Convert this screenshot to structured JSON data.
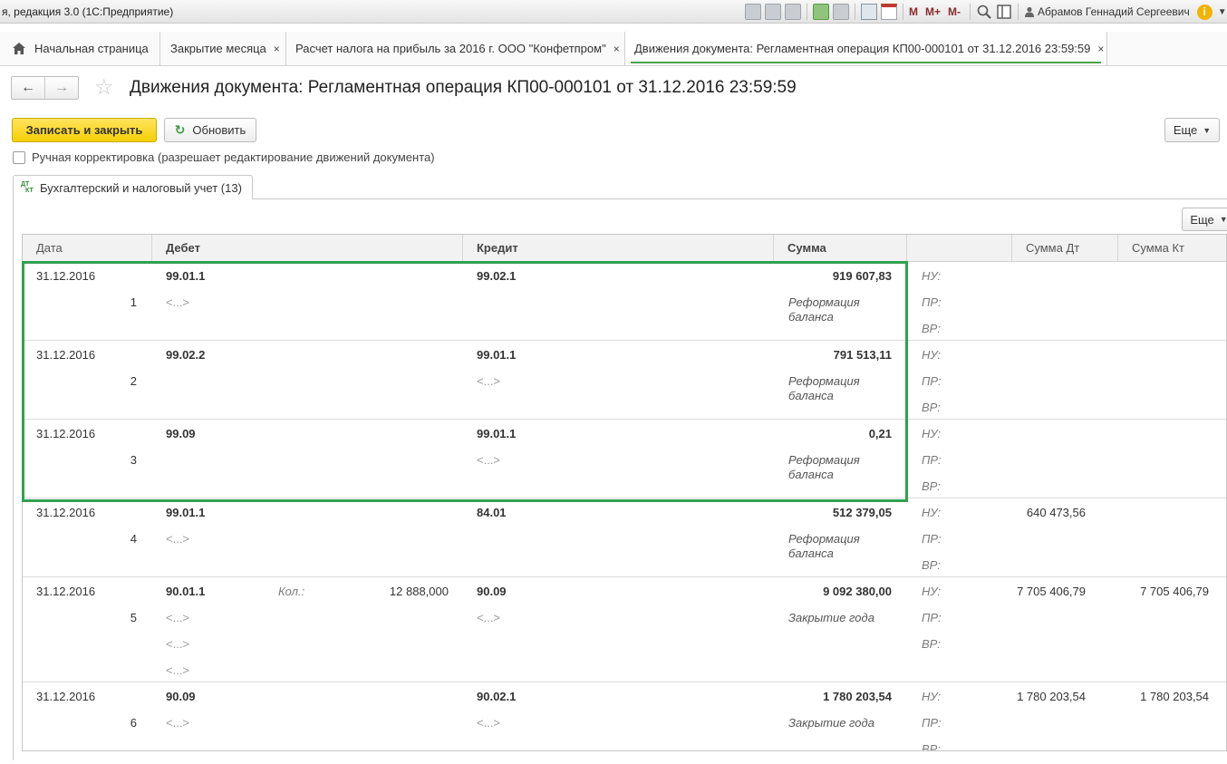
{
  "window": {
    "title": "я, редакция 3.0  (1С:Предприятие)",
    "user_name": "Абрамов Геннадий Сергеевич",
    "toolbar_labels": [
      "M",
      "M+",
      "M-"
    ]
  },
  "tabs": [
    {
      "label": "Начальная страница",
      "icon": "home-icon",
      "closable": false
    },
    {
      "label": "Закрытие месяца",
      "closable": true
    },
    {
      "label": "Расчет налога на прибыль за 2016 г. ООО \"Конфетпром\"",
      "closable": true
    },
    {
      "label": "Движения документа: Регламентная операция КП00-000101 от 31.12.2016 23:59:59",
      "closable": true,
      "active": true
    }
  ],
  "close_glyph": "×",
  "page": {
    "title": "Движения документа: Регламентная операция КП00-000101 от 31.12.2016 23:59:59",
    "back_glyph": "←",
    "forward_glyph": "→",
    "star_glyph": "☆"
  },
  "toolbar": {
    "save_close_label": "Записать и закрыть",
    "refresh_label": "Обновить",
    "more_label": "Еще"
  },
  "manual_edit": {
    "label": "Ручная корректировка (разрешает редактирование движений документа)",
    "checked": false
  },
  "inner_tab": {
    "label": "Бухгалтерский и налоговый учет (13)",
    "icon_top": "ДТ",
    "icon_bottom": "КТ"
  },
  "grid": {
    "more_label": "Еще",
    "columns": {
      "date": "Дата",
      "debit": "Дебет",
      "credit": "Кредит",
      "sum": "Сумма",
      "sum_dt": "Сумма Дт",
      "sum_kt": "Сумма Кт"
    },
    "tax_labels": [
      "НУ:",
      "ПР:",
      "ВР:"
    ],
    "placeholder": "<...>",
    "qty_label": "Кол.:",
    "rows": [
      {
        "date": "31.12.2016",
        "num": "1",
        "debit": "99.01.1",
        "debit_sub": [
          "<...>"
        ],
        "debit_qty": "",
        "credit": "99.02.1",
        "credit_sub": [],
        "sum": "919 607,83",
        "content": "Реформация баланса",
        "sum_dt": "",
        "sum_kt": ""
      },
      {
        "date": "31.12.2016",
        "num": "2",
        "debit": "99.02.2",
        "debit_sub": [],
        "debit_qty": "",
        "credit": "99.01.1",
        "credit_sub": [
          "<...>"
        ],
        "sum": "791 513,11",
        "content": "Реформация баланса",
        "sum_dt": "",
        "sum_kt": ""
      },
      {
        "date": "31.12.2016",
        "num": "3",
        "debit": "99.09",
        "debit_sub": [],
        "debit_qty": "",
        "credit": "99.01.1",
        "credit_sub": [
          "<...>"
        ],
        "sum": "0,21",
        "content": "Реформация баланса",
        "sum_dt": "",
        "sum_kt": ""
      },
      {
        "date": "31.12.2016",
        "num": "4",
        "debit": "99.01.1",
        "debit_sub": [
          "<...>"
        ],
        "debit_qty": "",
        "credit": "84.01",
        "credit_sub": [],
        "sum": "512 379,05",
        "content": "Реформация баланса",
        "sum_dt": "640 473,56",
        "sum_kt": ""
      },
      {
        "date": "31.12.2016",
        "num": "5",
        "debit": "90.01.1",
        "debit_sub": [
          "<...>",
          "<...>",
          "<...>"
        ],
        "debit_qty": "12 888,000",
        "credit": "90.09",
        "credit_sub": [
          "<...>"
        ],
        "sum": "9 092 380,00",
        "content": "Закрытие года",
        "sum_dt": "7 705 406,79",
        "sum_kt": "7 705 406,79"
      },
      {
        "date": "31.12.2016",
        "num": "6",
        "debit": "90.09",
        "debit_sub": [
          "<...>"
        ],
        "debit_qty": "",
        "credit": "90.02.1",
        "credit_sub": [
          "<...>"
        ],
        "sum": "1 780 203,54",
        "content": "Закрытие года",
        "sum_dt": "1 780 203,54",
        "sum_kt": "1 780 203,54"
      }
    ]
  },
  "colors": {
    "highlight": "#2fa14f",
    "primary_button": "#f5cf08",
    "active_tab_underline": "#4aa24a"
  }
}
